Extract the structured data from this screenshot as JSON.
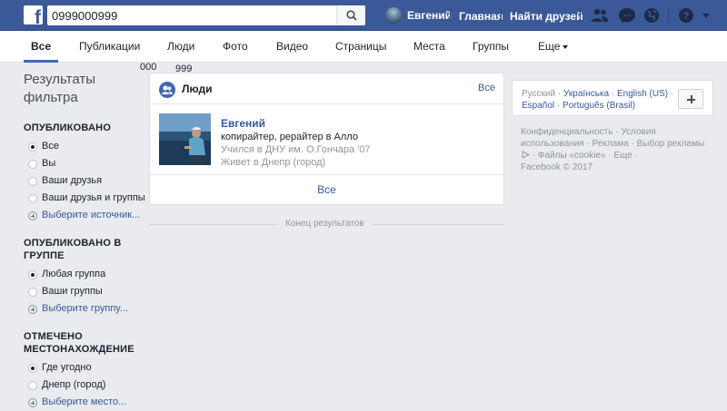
{
  "search": {
    "query": "0999000999"
  },
  "topnav": {
    "user_name": "Евгений",
    "home": "Главная",
    "find_friends": "Найти друзей"
  },
  "tabs": [
    {
      "label": "Все",
      "active": true
    },
    {
      "label": "Публикации"
    },
    {
      "label": "Люди"
    },
    {
      "label": "Фото"
    },
    {
      "label": "Видео"
    },
    {
      "label": "Страницы"
    },
    {
      "label": "Места"
    },
    {
      "label": "Группы"
    },
    {
      "label": "Еще"
    }
  ],
  "stray_text": {
    "left": "000",
    "right": "999"
  },
  "filters": {
    "title_line1": "Результаты",
    "title_line2": "фильтра",
    "groups": [
      {
        "title": "ОПУБЛИКОВАНО",
        "options": [
          "Все",
          "Вы",
          "Ваши друзья",
          "Ваши друзья и группы"
        ],
        "selected": 0,
        "choose": "Выберите источник..."
      },
      {
        "title_line1": "ОПУБЛИКОВАНО В",
        "title_line2": "ГРУППЕ",
        "options": [
          "Любая группа",
          "Ваши группы"
        ],
        "selected": 0,
        "choose": "Выберите группу..."
      },
      {
        "title_line1": "ОТМЕЧЕНО",
        "title_line2": "МЕСТОНАХОЖДЕНИЕ",
        "options": [
          "Где угодно",
          "Днепр (город)"
        ],
        "selected": 0,
        "choose": "Выберите место..."
      }
    ]
  },
  "people_card": {
    "title": "Люди",
    "see_all_top": "Все",
    "person": {
      "name": "Евгений",
      "line1": "копирайтер, рерайтер в Алло",
      "line2": "Учился в ДНУ им. О.Гончара '07",
      "line3": "Живет в Днепр (город)"
    },
    "see_all_bottom": "Все"
  },
  "end_of_results": "Конец результатов",
  "languages": {
    "current": "Русский",
    "items": [
      "Українська",
      "English (US)",
      "Español",
      "Português (Brasil)"
    ]
  },
  "footer": {
    "links": [
      "Конфиденциальность",
      "Условия использования",
      "Реклама",
      "Выбор рекламы",
      "Файлы «cookie»",
      "Еще"
    ],
    "copyright": "Facebook © 2017"
  },
  "colors": {
    "brand": "#3b5998",
    "link": "#385898",
    "background": "#e9ebee"
  }
}
